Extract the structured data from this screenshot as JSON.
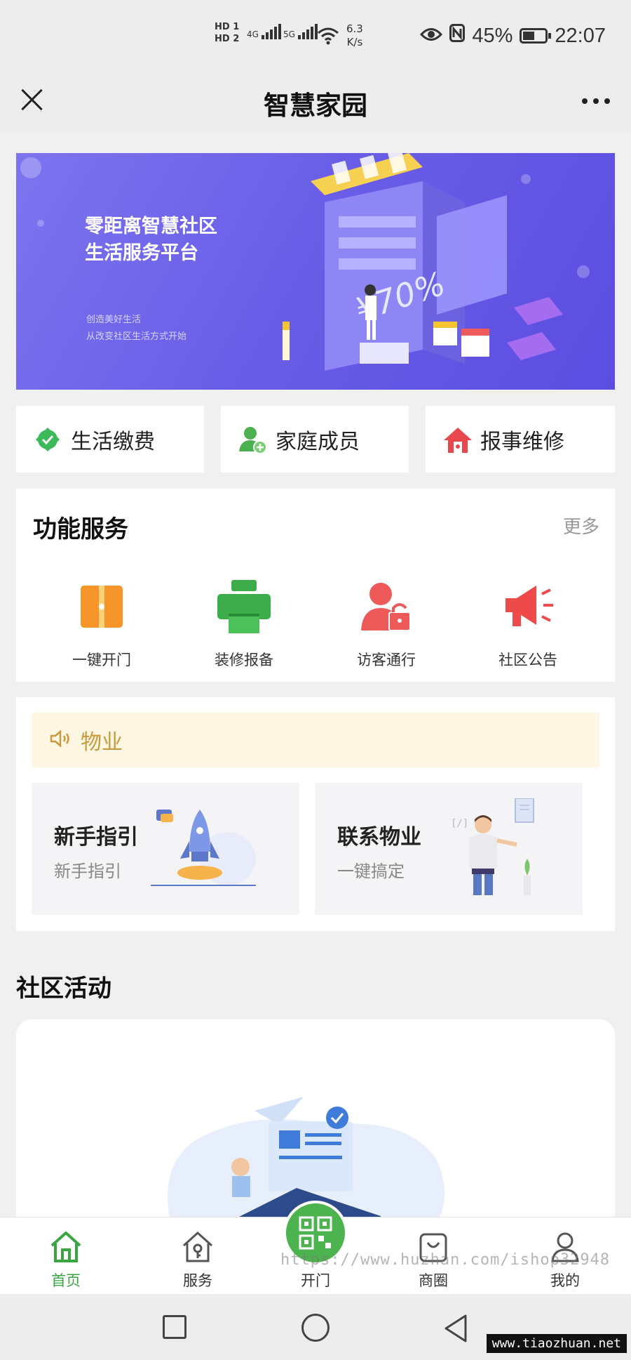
{
  "status_bar": {
    "hd1": "HD 1",
    "hd2": "HD 2",
    "net1": "4G",
    "net2": "5G",
    "speed_value": "6.3",
    "speed_unit": "K/s",
    "battery": "45%",
    "time": "22:07"
  },
  "header": {
    "title": "智慧家园"
  },
  "banner": {
    "title_line1": "零距离智慧社区",
    "title_line2": "生活服务平台",
    "sub_line1": "创造美好生活",
    "sub_line2": "从改变社区生活方式开始",
    "price_text": "¥70%"
  },
  "quick_actions": [
    {
      "label": "生活缴费",
      "icon": "payment-icon",
      "color": "#3cba5a"
    },
    {
      "label": "家庭成员",
      "icon": "family-icon",
      "color": "#4caf50"
    },
    {
      "label": "报事维修",
      "icon": "repair-icon",
      "color": "#e8474c"
    }
  ],
  "services": {
    "title": "功能服务",
    "more": "更多",
    "items": [
      {
        "label": "一键开门",
        "icon": "door-icon",
        "color": "#f5952a"
      },
      {
        "label": "装修报备",
        "icon": "printer-icon",
        "color": "#3dad4b"
      },
      {
        "label": "访客通行",
        "icon": "visitor-icon",
        "color": "#ee5a5a"
      },
      {
        "label": "社区公告",
        "icon": "megaphone-icon",
        "color": "#ee4a4a"
      }
    ]
  },
  "property": {
    "notice_label": "物业",
    "tiles": [
      {
        "title": "新手指引",
        "subtitle": "新手指引"
      },
      {
        "title": "联系物业",
        "subtitle": "一键搞定"
      }
    ]
  },
  "activities": {
    "title": "社区活动"
  },
  "tabbar": {
    "items": [
      {
        "label": "首页",
        "icon": "home-icon",
        "active": true
      },
      {
        "label": "服务",
        "icon": "service-house-icon",
        "active": false
      },
      {
        "label": "开门",
        "icon": "qr-code-icon",
        "active": false
      },
      {
        "label": "商圈",
        "icon": "shopping-bag-icon",
        "active": false
      },
      {
        "label": "我的",
        "icon": "profile-icon",
        "active": false
      }
    ]
  },
  "watermark": "https://www.huzhan.com/ishop32948",
  "site_mark": "www.tiaozhuan.net",
  "colors": {
    "accent": "#3aa642",
    "banner": "#6a5ee8",
    "notice_bg": "#fdf6e3",
    "notice_text": "#c99a3c"
  }
}
